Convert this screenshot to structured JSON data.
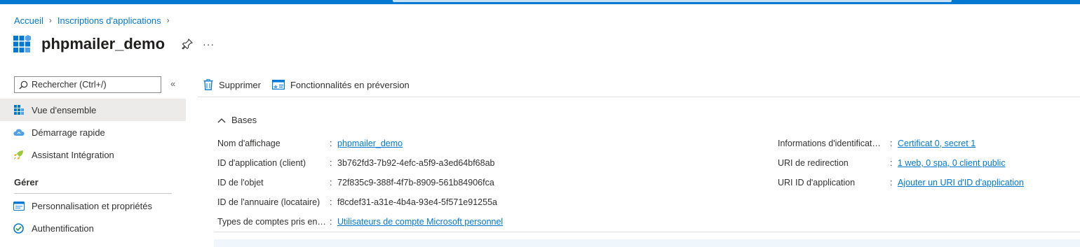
{
  "breadcrumb": {
    "items": [
      "Accueil",
      "Inscriptions d'applications"
    ]
  },
  "header": {
    "title": "phpmailer_demo",
    "more": "···"
  },
  "sidebar": {
    "search_placeholder": "Rechercher (Ctrl+/)",
    "collapse": "«",
    "items": [
      {
        "label": "Vue d'ensemble",
        "icon": "grid-icon",
        "active": true
      },
      {
        "label": "Démarrage rapide",
        "icon": "cloud-icon",
        "active": false
      },
      {
        "label": "Assistant Intégration",
        "icon": "rocket-icon",
        "active": false
      }
    ],
    "section": "Gérer",
    "manage_items": [
      {
        "label": "Personnalisation et propriétés",
        "icon": "branding-icon"
      },
      {
        "label": "Authentification",
        "icon": "auth-icon"
      }
    ]
  },
  "toolbar": {
    "delete_label": "Supprimer",
    "preview_label": "Fonctionnalités en préversion"
  },
  "essentials": {
    "toggle_label": "Bases",
    "left": [
      {
        "label": "Nom d'affichage",
        "value": "phpmailer_demo",
        "link": true
      },
      {
        "label": "ID d'application (client)",
        "value": "3b762fd3-7b92-4efc-a5f9-a3ed64bf68ab",
        "link": false
      },
      {
        "label": "ID de l'objet",
        "value": "72f835c9-388f-4f7b-8909-561b84906fca",
        "link": false
      },
      {
        "label": "ID de l'annuaire (locataire)",
        "value": "f8cdef31-a31e-4b4a-93e4-5f571e91255a",
        "link": false
      },
      {
        "label": "Types de comptes pris en…",
        "value": "Utilisateurs de compte Microsoft personnel",
        "link": true
      }
    ],
    "right": [
      {
        "label": "Informations d'identificat…",
        "value": "Certificat 0, secret 1",
        "link": true
      },
      {
        "label": "URI de redirection",
        "value": "1 web, 0 spa, 0 client public",
        "link": true
      },
      {
        "label": "URI ID d'application",
        "value": "Ajouter un URI d'ID d'application",
        "link": true
      }
    ],
    "separator": ":"
  },
  "colors": {
    "accent": "#0078d4",
    "active_nav": "#edebe9",
    "text": "#323130"
  }
}
